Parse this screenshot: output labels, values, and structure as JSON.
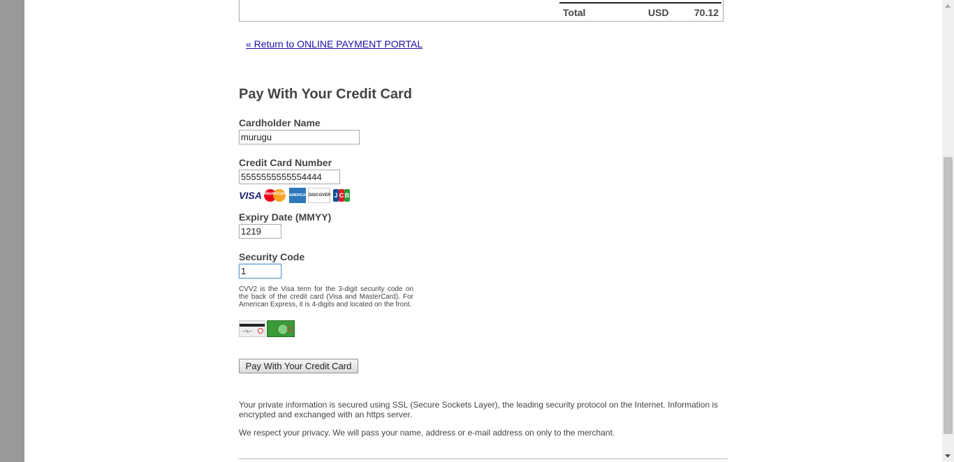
{
  "summary": {
    "total_label": "Total",
    "currency": "USD",
    "amount": "70.12"
  },
  "return_link": "« Return to ONLINE PAYMENT PORTAL",
  "form": {
    "title": "Pay With Your Credit Card",
    "cardholder_label": "Cardholder Name",
    "cardholder_value": "murugu",
    "card_number_label": "Credit Card Number",
    "card_number_value": "5555555555554444",
    "card_brands": [
      "VISA",
      "MasterCard",
      "AMERICAN EXPRESS",
      "DISCOVER",
      "JCB"
    ],
    "expiry_label": "Expiry Date (MMYY)",
    "expiry_value": "1219",
    "security_label": "Security Code",
    "security_value": "1",
    "cvv_note": "CVV2 is the Visa term for the 3-digit security code on the back of the credit card (Visa and MasterCard). For American Express, it is 4-digits and located on the front.",
    "submit_label": "Pay With Your Credit Card"
  },
  "info": {
    "security_text": "Your private information is secured using SSL (Secure Sockets Layer), the leading security protocol on the Internet. Information is encrypted and exchanged with an https server.",
    "privacy_text": "We respect your privacy. We will pass your name, address or e-mail address on only to the merchant."
  },
  "colors": {
    "link": "#1a0dab",
    "text": "#444444",
    "side_gutter": "#999999",
    "focus_border": "#5b9dd9"
  },
  "icons": [
    "visa-logo-icon",
    "mastercard-logo-icon",
    "amex-logo-icon",
    "discover-logo-icon",
    "jcb-logo-icon",
    "cvv-card-back-icon",
    "cvv-card-front-icon"
  ]
}
